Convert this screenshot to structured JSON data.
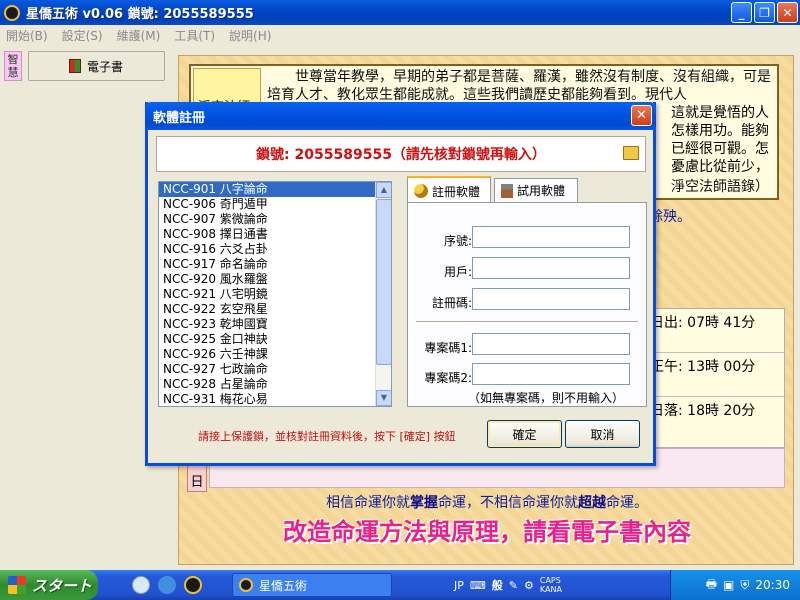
{
  "window": {
    "title": "星僑五術 v0.06   鎖號: 2055589555",
    "min_label": "_",
    "max_label": "❐",
    "close_label": "✕"
  },
  "menu": [
    "開始(B)",
    "設定(S)",
    "維護(M)",
    "工具(T)",
    "說明(H)"
  ],
  "left_panel": {
    "wisdom_tab": "智慧",
    "ebook_label": "電子書"
  },
  "content": {
    "quote_label": "淨空法師",
    "quote_text": "世尊當年教學，早期的弟子都是菩薩、羅漢，雖然沒有制度、沒有組織，可是培育人才、教化眾生都能成就。這些我們讀歷史都能夠看到。現代人",
    "quote_text_2": "這就是覺悟的人",
    "quote_text_3": "怎樣用功。能夠",
    "quote_text_4": "已經很可觀。怎",
    "quote_text_5": "憂慮比從前少，",
    "quote_source": "淨空法師語錄）",
    "blue_text": "餘殃。",
    "sun_rows": [
      "日出: 07時 41分",
      "正午: 13時 00分",
      "日落: 18時 20分"
    ],
    "day_label": "日",
    "bottom_line1_a": "相信命運你就",
    "bottom_line1_b": "掌握",
    "bottom_line1_c": "命運，不相信命運你就",
    "bottom_line1_d": "超越",
    "bottom_line1_e": "命運。",
    "bottom_line2": "改造命運方法與原理，請看電子書內容"
  },
  "dialog": {
    "title": "軟體註冊",
    "close_label": "✕",
    "lock_text": "鎖號: 2055589555（請先核對鎖號再輸入）",
    "software_list": [
      "NCC-901 八字論命",
      "NCC-906 奇門遁甲",
      "NCC-907 紫微論命",
      "NCC-908 擇日通書",
      "NCC-916 六爻占卦",
      "NCC-917 命名論命",
      "NCC-920 風水羅盤",
      "NCC-921 八宅明鏡",
      "NCC-922 玄空飛星",
      "NCC-923 乾坤國寶",
      "NCC-925 金口神訣",
      "NCC-926 六壬神課",
      "NCC-927 七政論命",
      "NCC-928 占星論命",
      "NCC-931 梅花心易"
    ],
    "selected_index": 0,
    "tabs": [
      "註冊軟體",
      "試用軟體"
    ],
    "fields": {
      "serial_label": "序號:",
      "user_label": "用戶:",
      "reg_code_label": "註冊碼:",
      "project1_label": "專案碼1:",
      "project2_label": "專案碼2:",
      "serial_value": "",
      "user_value": "",
      "reg_code_value": "",
      "project1_value": "",
      "project2_value": ""
    },
    "note": "（如無專案碼，則不用輸入）",
    "instruction": "請接上保護鎖，並核對註冊資料後，按下 [確定] 按鈕",
    "ok_label": "確定",
    "cancel_label": "取消"
  },
  "taskbar": {
    "start_label": "スタート",
    "task_label": "星僑五術",
    "tray_lang": "JP",
    "tray_ime": "般",
    "tray_caps": "CAPS",
    "tray_kana": "KANA",
    "clock": "20:30"
  },
  "colors": {
    "title_blue": "#0054e0",
    "lock_red": "#d01010",
    "slogan_pink": "#e8208a",
    "selection_blue": "#316ac5"
  }
}
